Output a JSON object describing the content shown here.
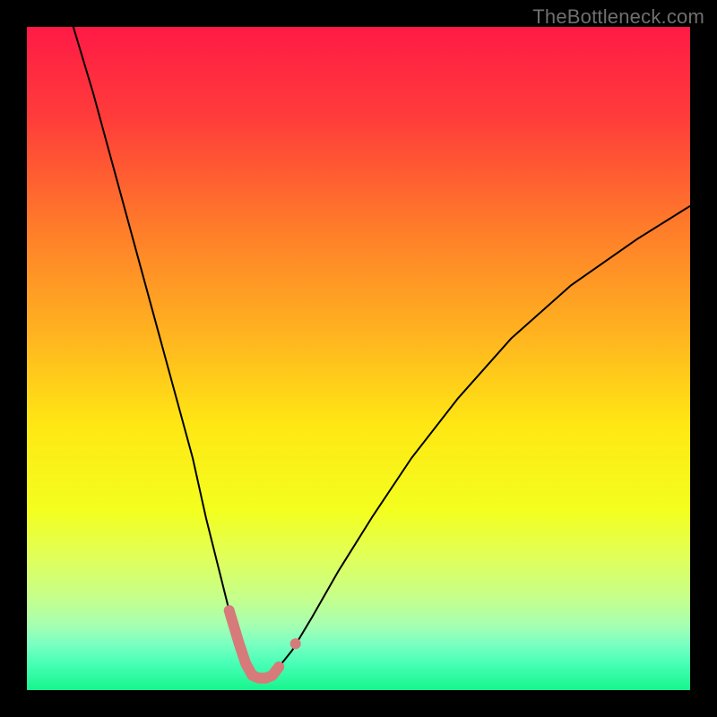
{
  "watermark": {
    "text": "TheBottleneck.com"
  },
  "chart_data": {
    "type": "line",
    "title": "",
    "xlabel": "",
    "ylabel": "",
    "xlim": [
      0,
      100
    ],
    "ylim": [
      0,
      100
    ],
    "grid": false,
    "legend": false,
    "background_gradient_stops": [
      {
        "pct": 0,
        "color": "#ff1a46"
      },
      {
        "pct": 14,
        "color": "#ff3d3a"
      },
      {
        "pct": 30,
        "color": "#ff7b2a"
      },
      {
        "pct": 46,
        "color": "#ffb220"
      },
      {
        "pct": 60,
        "color": "#ffe714"
      },
      {
        "pct": 73,
        "color": "#f3ff1f"
      },
      {
        "pct": 80,
        "color": "#e0ff5a"
      },
      {
        "pct": 86,
        "color": "#c6ff8a"
      },
      {
        "pct": 90,
        "color": "#a8ffb0"
      },
      {
        "pct": 93,
        "color": "#7bffc2"
      },
      {
        "pct": 96,
        "color": "#48ffb6"
      },
      {
        "pct": 100,
        "color": "#17f58d"
      }
    ],
    "series": [
      {
        "name": "bottleneck-curve",
        "color": "#000000",
        "width": 2,
        "x": [
          7,
          10,
          13,
          16,
          19,
          22,
          25,
          27,
          29,
          30.5,
          32,
          33,
          34,
          35,
          36,
          37,
          38,
          40,
          43,
          47,
          52,
          58,
          65,
          73,
          82,
          92,
          100
        ],
        "y": [
          100,
          90,
          79,
          68,
          57,
          46,
          35,
          26,
          18,
          12,
          7,
          4,
          2.2,
          1.8,
          1.8,
          2.2,
          3.5,
          6,
          11,
          18,
          26,
          35,
          44,
          53,
          61,
          68,
          73
        ]
      },
      {
        "name": "highlight-trough",
        "color": "#d77a7a",
        "width": 12,
        "linecap": "round",
        "x": [
          30.5,
          32,
          33,
          34,
          35,
          36,
          37,
          38
        ],
        "y": [
          12,
          7,
          4,
          2.2,
          1.8,
          1.8,
          2.2,
          3.5
        ]
      }
    ],
    "markers": [
      {
        "name": "highlight-dot",
        "x": 40.5,
        "y": 7,
        "r": 6,
        "color": "#d77a7a"
      }
    ]
  }
}
